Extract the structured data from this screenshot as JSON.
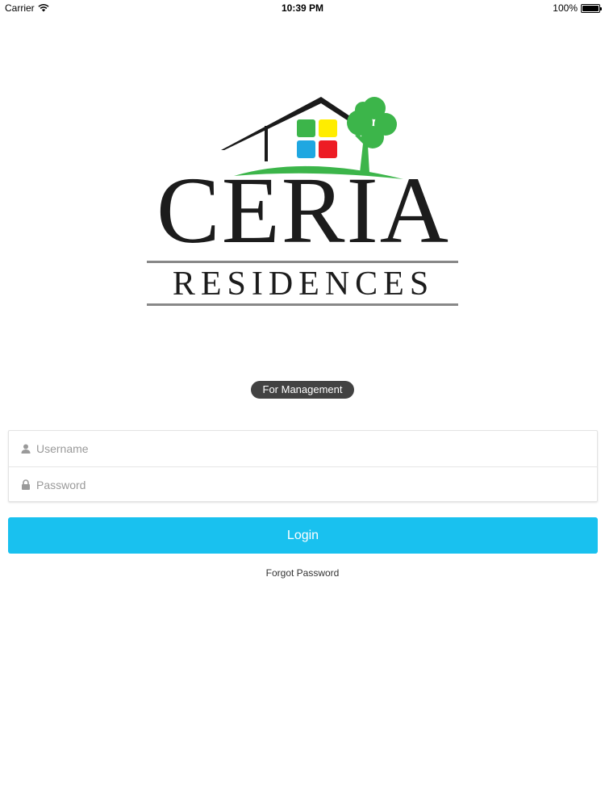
{
  "status_bar": {
    "carrier": "Carrier",
    "time": "10:39 PM",
    "battery": "100%",
    "battery_level": 1.0,
    "wifi_icon": "wifi-icon"
  },
  "logo": {
    "brand_name": "CERIA",
    "sub_name": "RESIDENCES",
    "colors": {
      "roof": "#1a1a1a",
      "window_green": "#3cb54a",
      "window_yellow": "#ffed00",
      "window_blue": "#1fa7e1",
      "window_red": "#ed1c24",
      "tree": "#3cb54a",
      "lawn": "#3cb54a",
      "text": "#1c1c1c",
      "rule": "#888888"
    }
  },
  "badge": {
    "label": "For Management"
  },
  "form": {
    "username": {
      "placeholder": "Username",
      "value": "",
      "icon": "user-icon"
    },
    "password": {
      "placeholder": "Password",
      "value": "",
      "icon": "lock-icon"
    }
  },
  "actions": {
    "login_label": "Login",
    "forgot_label": "Forgot Password"
  },
  "colors": {
    "accent": "#19c1ef",
    "badge_bg": "#424242"
  }
}
